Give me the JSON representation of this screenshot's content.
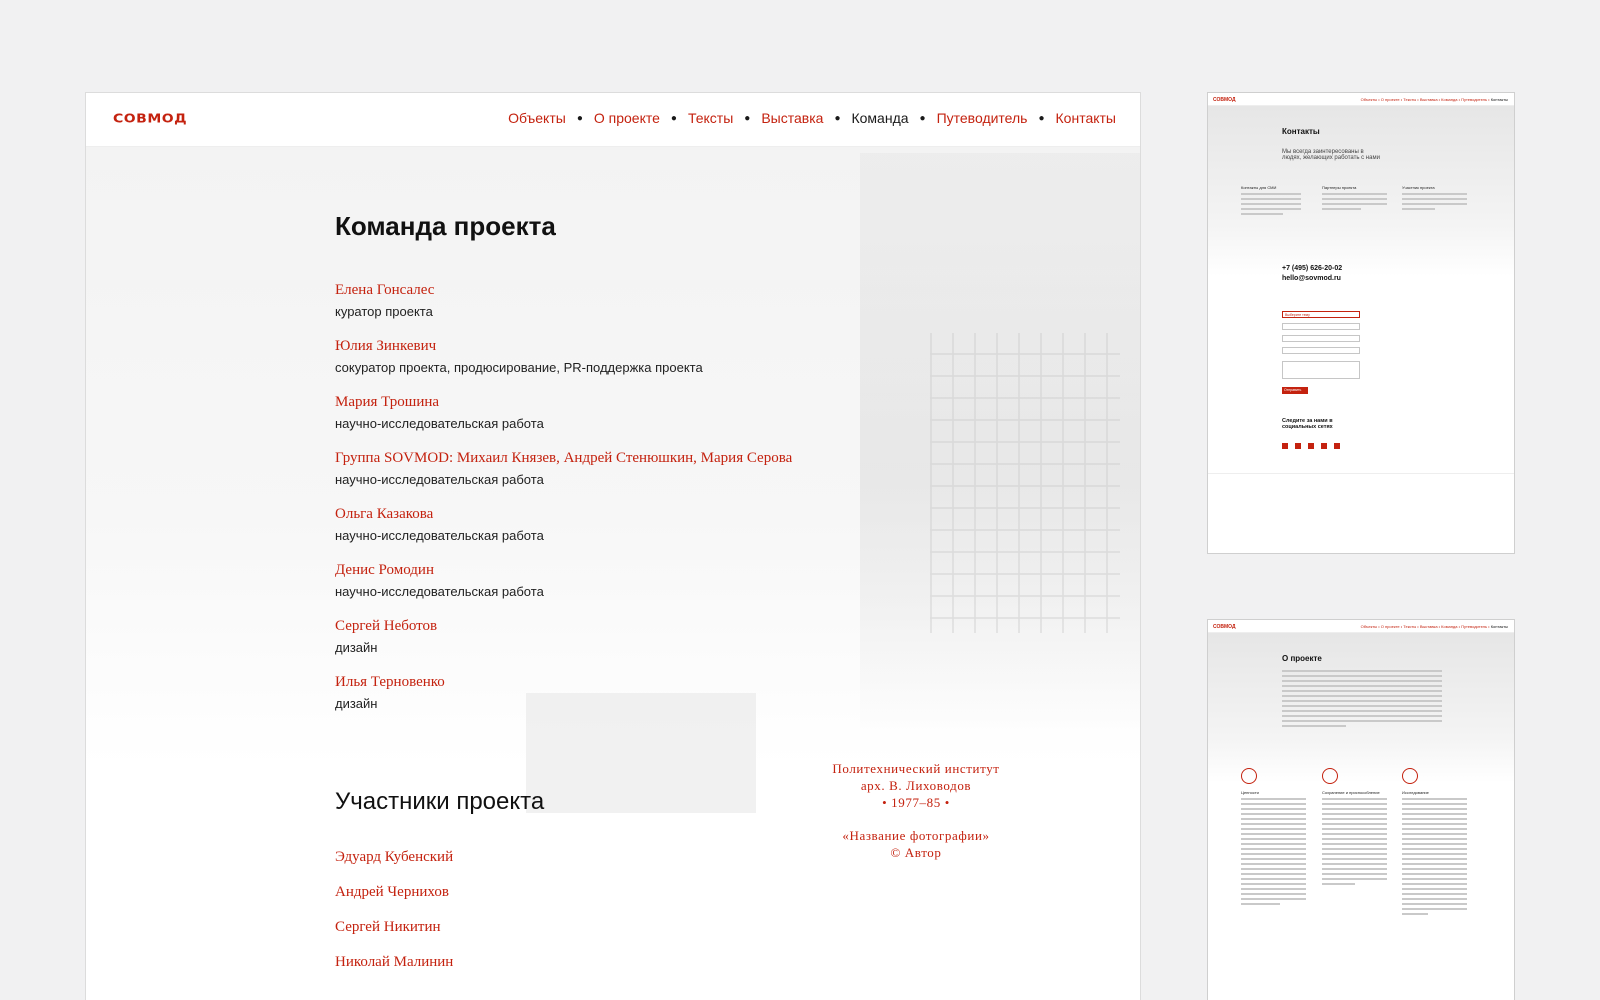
{
  "brand": {
    "logo": "СОВМОД",
    "accent": "#c4220f"
  },
  "nav": {
    "items": [
      {
        "label": "Объекты",
        "active": false
      },
      {
        "label": "О проекте",
        "active": false
      },
      {
        "label": "Тексты",
        "active": false
      },
      {
        "label": "Выставка",
        "active": false
      },
      {
        "label": "Команда",
        "active": true
      },
      {
        "label": "Путеводитель",
        "active": false
      },
      {
        "label": "Контакты",
        "active": false
      }
    ]
  },
  "team": {
    "title": "Команда проекта",
    "members": [
      {
        "name": "Елена Гонсалес",
        "role": "куратор проекта"
      },
      {
        "name": "Юлия Зинкевич",
        "role": "сокуратор проекта, продюсирование, PR-поддержка проекта"
      },
      {
        "name": "Мария Трошина",
        "role": "научно-исследовательская работа"
      },
      {
        "name": "Группа SOVMOD: Михаил Князев, Андрей Стенюшкин, Мария Серова",
        "role": "научно-исследовательская работа"
      },
      {
        "name": "Ольга Казакова",
        "role": "научно-исследовательская работа"
      },
      {
        "name": "Денис Ромодин",
        "role": "научно-исследовательская работа"
      },
      {
        "name": "Сергей Неботов",
        "role": "дизайн"
      },
      {
        "name": "Илья Терновенко",
        "role": "дизайн"
      }
    ]
  },
  "participants": {
    "title": "Участники проекта",
    "names": [
      "Эдуард Кубенский",
      "Андрей Чернихов",
      "Сергей Никитин",
      "Николай Малинин"
    ]
  },
  "caption": {
    "line1": "Политехнический институт",
    "line2": "арх. В. Лиховодов",
    "line3": "• 1977–85 •",
    "line4": "«Название фотографии»",
    "line5": "© Автор"
  },
  "thumb_contacts": {
    "logo": "СОВМОД",
    "nav": "Объекты • О проекте • Тексты • Выставка • Команда • Путеводитель •",
    "nav_active": "Контакты",
    "title": "Контакты",
    "lead": "Мы всегда заинтересованы в людях, желающих работать с нами",
    "col1": "Контакты для СМИ",
    "col2": "Партнеры проекта",
    "col3": "Участник проекта",
    "phone": "+7 (495) 626-20-02",
    "email": "hello@sovmod.ru",
    "select": "Выберите тему",
    "submit": "Отправить",
    "social_title": "Следите за нами в социальных сетях"
  },
  "thumb_about": {
    "logo": "СОВМОД",
    "nav": "Объекты • О проекте • Тексты • Выставка • Команда • Путеводитель •",
    "nav_active": "Контакты",
    "title": "О проекте",
    "col1": "Ценности",
    "col2": "Сохранение и приспособление",
    "col3": "Исследование"
  }
}
